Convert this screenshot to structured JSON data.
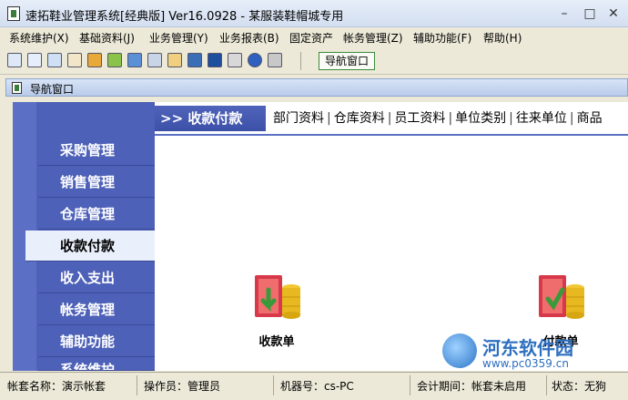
{
  "window": {
    "title": "速拓鞋业管理系统[经典版] Ver16.0928  -  某服装鞋帽城专用",
    "min": "–",
    "max": "□",
    "close": "✕"
  },
  "menu": [
    "系统维护(X)",
    "基础资料(J)",
    "业务管理(Y)",
    "业务报表(B)",
    "固定资产",
    "帐务管理(Z)",
    "辅助功能(F)",
    "帮助(H)"
  ],
  "toolbar": {
    "nav_button": "导航窗口"
  },
  "inner_window": {
    "title": "导航窗口"
  },
  "sidebar": {
    "items": [
      "采购管理",
      "销售管理",
      "仓库管理",
      "收款付款",
      "收入支出",
      "帐务管理",
      "辅助功能",
      "系统维护"
    ],
    "active_index": 3
  },
  "header": {
    "title": ">> 收款付款",
    "links": [
      "部门资料",
      "仓库资料",
      "员工资料",
      "单位类别",
      "往来单位",
      "商品"
    ]
  },
  "content": {
    "items": [
      {
        "label": "收款单"
      },
      {
        "label": "付款单"
      }
    ]
  },
  "watermark": {
    "name": "河东软件园",
    "url": "www.pc0359.cn"
  },
  "status": {
    "account": "帐套名称：演示帐套",
    "operator": "操作员：管理员",
    "machine": "机器号：cs-PC",
    "period": "会计期间：帐套未启用",
    "state": "状态：无狗"
  },
  "colors": {
    "sidebar": "#4e61b8",
    "active": "#eaf0fb",
    "nav_border": "#3b8a3b"
  }
}
